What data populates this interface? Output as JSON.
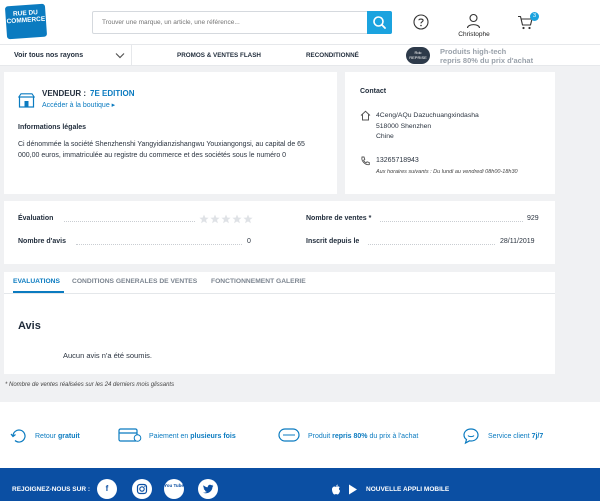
{
  "header": {
    "logo_line1": "RUE DU",
    "logo_line2": "COMMERCE",
    "search_placeholder": "Trouver une marque, un article, une référence...",
    "user_name": "Christophe",
    "cart_count": "3"
  },
  "nav": {
    "rayons": "Voir tous nos rayons",
    "promos": "PROMOS & VENTES FLASH",
    "recond": "RECONDITIONNÉ",
    "badge_line1": "Rdc",
    "badge_line2": "REPRISE",
    "hightech_line1": "Produits high-tech",
    "hightech_line2": "repris 80% du prix d'achat"
  },
  "vendor": {
    "label": "VENDEUR :",
    "name": "7E EDITION",
    "shop_link": "Accéder à la boutique ▸",
    "legal_heading": "Informations légales",
    "legal_text": "Ci dénommée la société Shenzhenshi Yangyidianzishangwu Youxiangongsi, au capital de 65 000,00 euros, immatriculée au registre du commerce et des sociétés sous le numéro 0"
  },
  "contact": {
    "heading": "Contact",
    "addr1": "4Ceng/AQu Dazuchuangxindasha",
    "addr2": "518000 Shenzhen",
    "addr3": "Chine",
    "phone": "13265718943",
    "hours": "Aux horaires suivants : Du lundi au vendredi 08h00-18h30"
  },
  "stats": {
    "evaluation_label": "Évaluation",
    "rating_stars": 0,
    "nb_avis_label": "Nombre d'avis",
    "nb_avis_value": "0",
    "ventes_label": "Nombre de ventes *",
    "ventes_value": "929",
    "inscrit_label": "Inscrit depuis le",
    "inscrit_value": "28/11/2019"
  },
  "tabs": {
    "evaluations": "EVALUATIONS",
    "cgv": "CONDITIONS GENERALES DE VENTES",
    "galerie": "FONCTIONNEMENT GALERIE"
  },
  "reviews": {
    "heading": "Avis",
    "empty": "Aucun avis n'a été soumis."
  },
  "footnote": "* Nombre de ventes réalisées sur les 24 derniers mois glissants",
  "reassurance": {
    "retour_a": "Retour ",
    "retour_b": "gratuit",
    "paiement_a": "Paiement en ",
    "paiement_b": "plusieurs fois",
    "produit_a": "Produit ",
    "produit_b": "repris 80%",
    "produit_c": " du prix à l'achat",
    "service_a": "Service client ",
    "service_b": "7j/7"
  },
  "footer": {
    "join": "REJOIGNEZ-NOUS SUR :",
    "facebook": "f",
    "youtube": "You Tube",
    "app": "NOUVELLE APPLI MOBILE"
  },
  "colors": {
    "brand_blue": "#0b7bc0",
    "search_blue": "#1ba3df",
    "footer_blue": "#0b4fa3"
  }
}
